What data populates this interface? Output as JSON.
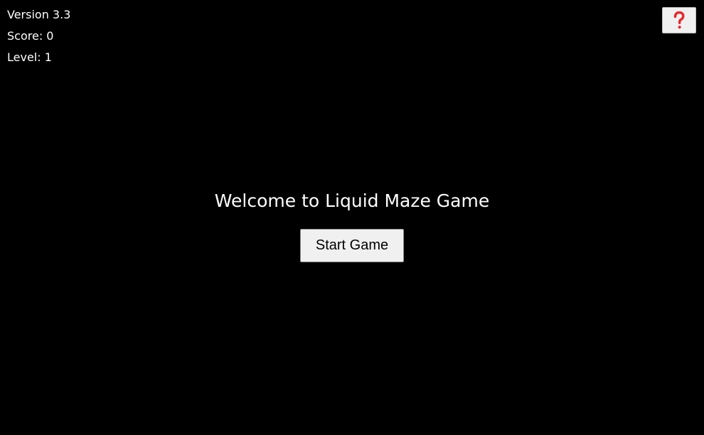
{
  "hud": {
    "version": "Version 3.3",
    "score": "Score: 0",
    "level": "Level: 1"
  },
  "help_button": {
    "icon": "question-mark-icon",
    "icon_color": "#e8262b"
  },
  "main": {
    "title": "Welcome to Liquid Maze Game",
    "start_label": "Start Game"
  },
  "colors": {
    "background": "#000000",
    "text": "#ffffff",
    "button_bg": "#f0f0f0"
  }
}
